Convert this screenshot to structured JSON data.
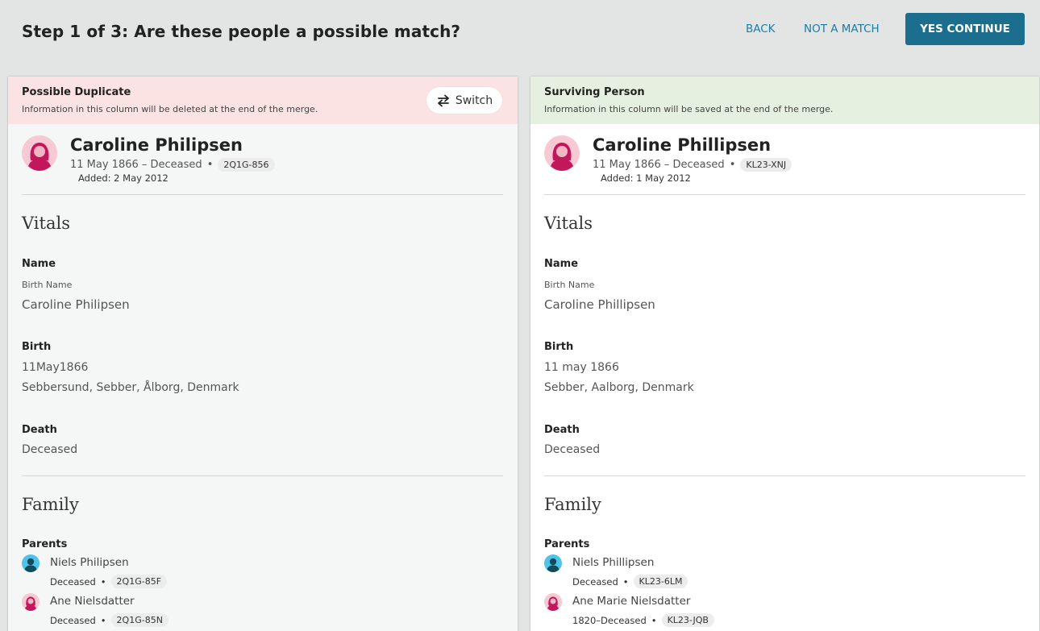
{
  "header": {
    "title": "Step 1 of 3: Are these people a possible match?",
    "back_label": "BACK",
    "not_match_label": "NOT A MATCH",
    "yes_label": "YES CONTINUE"
  },
  "left": {
    "banner_title": "Possible Duplicate",
    "banner_sub": "Information in this column will be deleted at the end of the merge.",
    "switch_label": "Switch",
    "person": {
      "name": "Caroline Philipsen",
      "dates": "11 May 1866 – Deceased",
      "sep": "•",
      "id": "2Q1G-856",
      "added": "Added: 2 May 2012"
    },
    "vitals_heading": "Vitals",
    "name_heading": "Name",
    "birth_name_label": "Birth Name",
    "birth_name": "Caroline Philipsen",
    "birth_heading": "Birth",
    "birth_date": "11May1866",
    "birth_place": "Sebbersund, Sebber, Ålborg, Denmark",
    "death_heading": "Death",
    "death_value": "Deceased",
    "family_heading": "Family",
    "parents_heading": "Parents",
    "parents": [
      {
        "name": "Niels Philipsen",
        "dates": "Deceased",
        "sep": "•",
        "id": "2Q1G-85F",
        "gender": "male"
      },
      {
        "name": "Ane Nielsdatter",
        "dates": "Deceased",
        "sep": "•",
        "id": "2Q1G-85N",
        "gender": "female"
      }
    ]
  },
  "right": {
    "banner_title": "Surviving Person",
    "banner_sub": "Information in this column will be saved at the end of the merge.",
    "person": {
      "name": "Caroline Phillipsen",
      "dates": "11 May 1866 – Deceased",
      "sep": "•",
      "id": "KL23-XNJ",
      "added": "Added: 1 May 2012"
    },
    "vitals_heading": "Vitals",
    "name_heading": "Name",
    "birth_name_label": "Birth Name",
    "birth_name": "Caroline Phillipsen",
    "birth_heading": "Birth",
    "birth_date": "11 may 1866",
    "birth_place": "Sebber, Aalborg, Denmark",
    "death_heading": "Death",
    "death_value": "Deceased",
    "family_heading": "Family",
    "parents_heading": "Parents",
    "parents": [
      {
        "name": "Niels Phillipsen",
        "dates": "Deceased",
        "sep": "•",
        "id": "KL23-6LM",
        "gender": "male"
      },
      {
        "name": "Ane Marie Nielsdatter",
        "dates": "1820–Deceased",
        "sep": "•",
        "id": "KL23-JQB",
        "gender": "female"
      }
    ]
  },
  "colors": {
    "accent": "#1b6e8e",
    "link": "#1a7ea6",
    "duplicate_banner": "#fce3e3",
    "surviving_banner": "#e6f0e0",
    "female": "#c2185b",
    "male": "#4fc3e8"
  }
}
